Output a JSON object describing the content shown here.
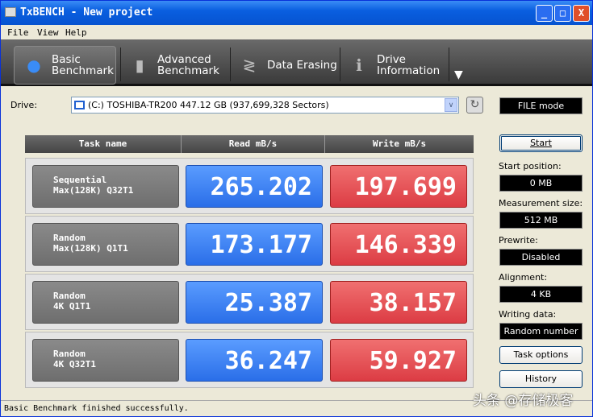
{
  "window": {
    "title": "TxBENCH - New project",
    "minimize": "_",
    "maximize": "□",
    "close": "X"
  },
  "menu": [
    "File",
    "View",
    "Help"
  ],
  "toolbar": {
    "tabs": [
      {
        "line1": "Basic",
        "line2": "Benchmark",
        "icon": "stopwatch-icon"
      },
      {
        "line1": "Advanced",
        "line2": "Benchmark",
        "icon": "bar-chart-icon"
      },
      {
        "line1": "Data Erasing",
        "line2": "",
        "icon": "eraser-icon"
      },
      {
        "line1": "Drive",
        "line2": "Information",
        "icon": "drive-info-icon"
      }
    ],
    "more": "▼"
  },
  "drive": {
    "label": "Drive:",
    "value": "(C:) TOSHIBA-TR200  447.12 GB (937,699,328 Sectors)",
    "arrow": "∨",
    "refresh": "↻"
  },
  "mode": "FILE mode",
  "table": {
    "headers": [
      "Task name",
      "Read mB/s",
      "Write mB/s"
    ],
    "rows": [
      {
        "l1": "Sequential",
        "l2": "Max(128K) Q32T1",
        "read": "265.202",
        "write": "197.699"
      },
      {
        "l1": "Random",
        "l2": "Max(128K) Q1T1",
        "read": "173.177",
        "write": "146.339"
      },
      {
        "l1": "Random",
        "l2": "4K Q1T1",
        "read": "25.387",
        "write": "38.157"
      },
      {
        "l1": "Random",
        "l2": "4K Q32T1",
        "read": "36.247",
        "write": "59.927"
      }
    ]
  },
  "side": {
    "start": "Start",
    "start_position_label": "Start position:",
    "start_position": "0 MB",
    "measurement_label": "Measurement size:",
    "measurement": "512 MB",
    "prewrite_label": "Prewrite:",
    "prewrite": "Disabled",
    "alignment_label": "Alignment:",
    "alignment": "4 KB",
    "writing_label": "Writing data:",
    "writing": "Random number",
    "task_options": "Task options",
    "history": "History"
  },
  "status": "Basic Benchmark finished successfully.",
  "watermark": "头条 @存储极客"
}
